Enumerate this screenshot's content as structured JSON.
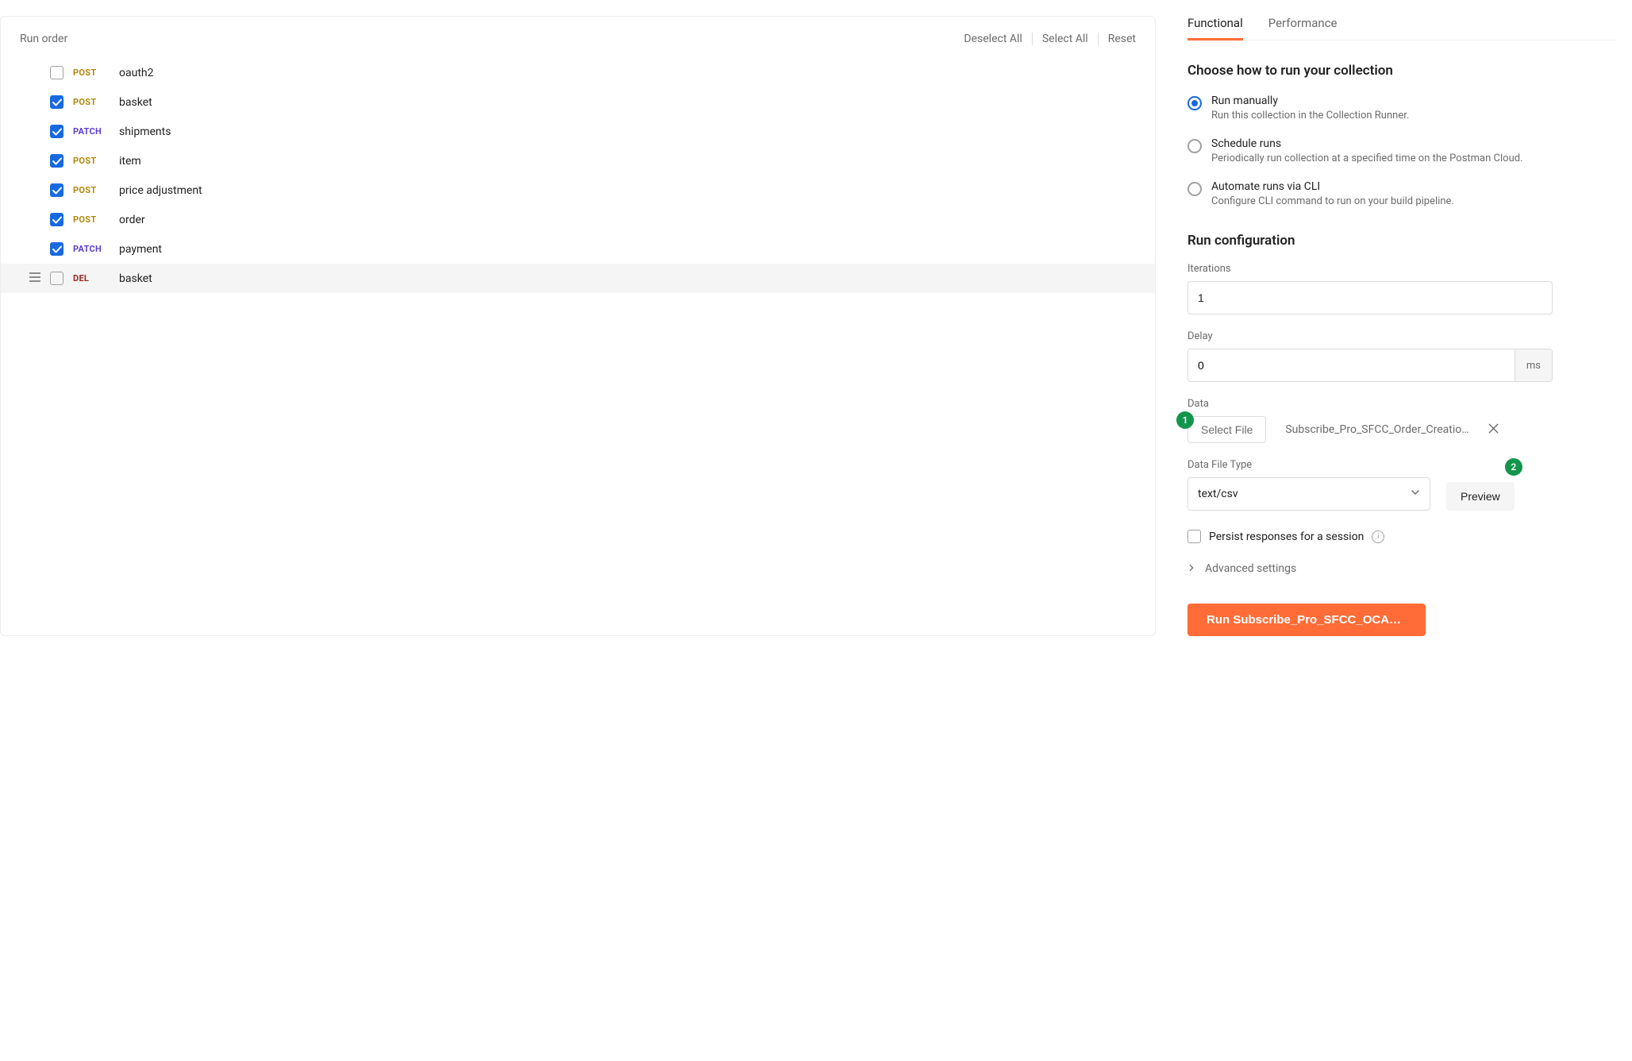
{
  "left": {
    "title": "Run order",
    "actions": {
      "deselect_all": "Deselect All",
      "select_all": "Select All",
      "reset": "Reset"
    },
    "requests": [
      {
        "method": "POST",
        "method_class": "method-post",
        "name": "oauth2",
        "checked": false,
        "hovered": false
      },
      {
        "method": "POST",
        "method_class": "method-post",
        "name": "basket",
        "checked": true,
        "hovered": false
      },
      {
        "method": "PATCH",
        "method_class": "method-patch",
        "name": "shipments",
        "checked": true,
        "hovered": false
      },
      {
        "method": "POST",
        "method_class": "method-post",
        "name": "item",
        "checked": true,
        "hovered": false
      },
      {
        "method": "POST",
        "method_class": "method-post",
        "name": "price adjustment",
        "checked": true,
        "hovered": false
      },
      {
        "method": "POST",
        "method_class": "method-post",
        "name": "order",
        "checked": true,
        "hovered": false
      },
      {
        "method": "PATCH",
        "method_class": "method-patch",
        "name": "payment",
        "checked": true,
        "hovered": false
      },
      {
        "method": "DEL",
        "method_class": "method-del",
        "name": "basket",
        "checked": false,
        "hovered": true
      }
    ]
  },
  "right": {
    "tabs": {
      "functional": "Functional",
      "performance": "Performance"
    },
    "choose_title": "Choose how to run your collection",
    "options": [
      {
        "label": "Run manually",
        "desc": "Run this collection in the Collection Runner.",
        "selected": true
      },
      {
        "label": "Schedule runs",
        "desc": "Periodically run collection at a specified time on the Postman Cloud.",
        "selected": false
      },
      {
        "label": "Automate runs via CLI",
        "desc": "Configure CLI command to run on your build pipeline.",
        "selected": false
      }
    ],
    "config_title": "Run configuration",
    "iterations_label": "Iterations",
    "iterations_value": "1",
    "delay_label": "Delay",
    "delay_value": "0",
    "delay_unit": "ms",
    "data_label": "Data",
    "select_file_label": "Select File",
    "file_name": "Subscribe_Pro_SFCC_Order_Creatio…",
    "file_type_label": "Data File Type",
    "file_type_value": "text/csv",
    "preview_label": "Preview",
    "persist_label": "Persist responses for a session",
    "advanced_label": "Advanced settings",
    "run_button": "Run Subscribe_Pro_SFCC_OCAP…",
    "badges": {
      "one": "1",
      "two": "2"
    }
  }
}
